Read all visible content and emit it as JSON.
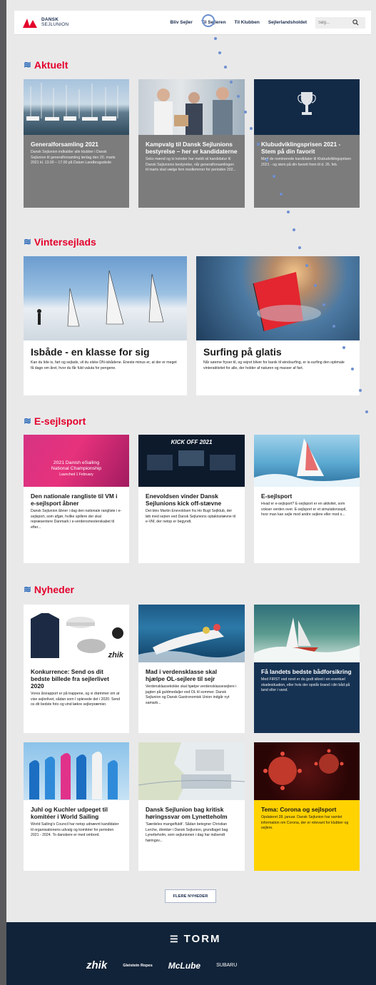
{
  "header": {
    "logo_text_1": "DANSK",
    "logo_text_2": "SEJLUNION",
    "nav": [
      "Bliv Sejler",
      "Til Sejleren",
      "Til Klubben",
      "Sejlerlandsholdet"
    ],
    "search_placeholder": "Søg..."
  },
  "sections": {
    "aktuelt": "Aktuelt",
    "vintersejlads": "Vintersejlads",
    "esejlsport": "E-sejlsport",
    "nyheder": "Nyheder"
  },
  "aktuelt": [
    {
      "title": "Generalforsamling 2021",
      "text": "Dansk Sejlunion indkalder alle klubber i Dansk Sejlunion til generalforsamling lørdag den 20. marts 2021 kl. 13.00 – 17.00 på Dalum Landbrugsskole"
    },
    {
      "title": "Kampvalg til Dansk Sejlunions bestyrelse – her er kandidaterne",
      "text": "Seks mænd og to kvinder har meldt sit kandidatur til Dansk Sejlunions bestyrelse, når generalforsamlingen til marts skal vælge fem medlemmer for perioden 202..."
    },
    {
      "title": "Klubudviklingsprisen 2021 - Stem på din favorit",
      "text": "Mød de nominerede kandidater til Klubudviklingsprisen 2021 - og stem på din favorit frem til d. 26. feb."
    }
  ],
  "vinter": [
    {
      "title": "Isbåde - en klasse for sig",
      "text": "Kan du lide is, fart og sejlads, vil du elske DN-isbådene. Eneste minus er, at der er meget få dage om året, hvor du får fuld valuta for pengene."
    },
    {
      "title": "Surfing på glatis",
      "text": "Når søerne fryser til, og vejret bliver for barsk til windsurfing, er is-surfing den optimale vinteraktivitet for alle, der holder af naturen og masser af fart."
    }
  ],
  "esejl": [
    {
      "title": "Den nationale rangliste til VM i e-sejlsport åbner",
      "text": "Dansk Sejlunion åbner i dag den nationale rangliste i e-sejlsport, som afgør, hvilke spillere der skal repræsentere Danmark i e-verdensmesterskabet til efter...",
      "img_line1": "2021 Danish eSailing",
      "img_line2": "National Championship",
      "img_line3": "Launched 1 February"
    },
    {
      "title": "Enevoldsen vinder Dansk Sejlunions kick off-stævne",
      "text": "Det blev Martin Enevoldsen fra Ho Bugt Sejlklub, der løb med sejren ved Dansk Sejlunions optaktsstævne til e-VM, der netop er begyndt.",
      "img_title": "KICK OFF 2021"
    },
    {
      "title": "E-sejlsport",
      "text": "Hvad er e-sejlsport? E-sejlsport er en aktivitet, som vokser verden over. E-sejlsport er et simulationsspil, hvor man kan sejle mod andre sejlere eller mod s..."
    }
  ],
  "nyheder": [
    {
      "title": "Konkurrence: Send os dit bedste billede fra sejlerlivet 2020",
      "text": "Vores årsrapport er på trappene, og vi drømmer om at vise sejlerlivet, sådan som I oplevede det i 2020. Send os dit bedste foto og vind lækre sejlerpræmier.",
      "img_brand": "zhik"
    },
    {
      "title": "Mad i verdensklasse skal hjælpe OL-sejlere til sejr",
      "text": "Verdensklassekokke skal hjælpe verdensklassesejlere i jagten på guldmedaljer ved OL til sommer. Dansk Sejlunion og Dansk Gastronomisk Union indgår nyt samarb..."
    },
    {
      "title": "Få landets bedste bådforsikring",
      "text": "Med FIRST ved roret er du godt sikret i en eventuel skadesituation, eller hvis der opstår brand i din båd på land eller i vand."
    },
    {
      "title": "Juhl og Kuchler udpeget til komitéer i World Sailing",
      "text": "World Sailing's Council har netop udnævnt kandidater til organisationens udvalg og komitéer for perioden 2021 - 2024. To danskere er med ombord."
    },
    {
      "title": "Dansk Sejlunion bag kritisk høringssvar om Lynetteholm",
      "text": "'Særdeles mangelfuldt'. Sådan betegner Christian Lerche, direktør i Dansk Sejlunion, grundlaget bag Lynetteholm, som sejlunionen i dag har indsendt høringsv..."
    },
    {
      "title": "Tema: Corona og sejlsport",
      "text": "Opdateret 28. januar. Dansk Sejlunion har samlet information om Corona, der er relevant for klubber og sejlere."
    }
  ],
  "more_button": "FLERE NYHEDER",
  "footer": {
    "main_sponsor": "TORM",
    "sponsors": [
      "zhik",
      "Gleistein Ropes",
      "McLube",
      "SUBARU"
    ]
  },
  "colors": {
    "accent": "#e4002b",
    "navy": "#163253",
    "yellow": "#ffd200",
    "grey": "#7c7c7c"
  }
}
